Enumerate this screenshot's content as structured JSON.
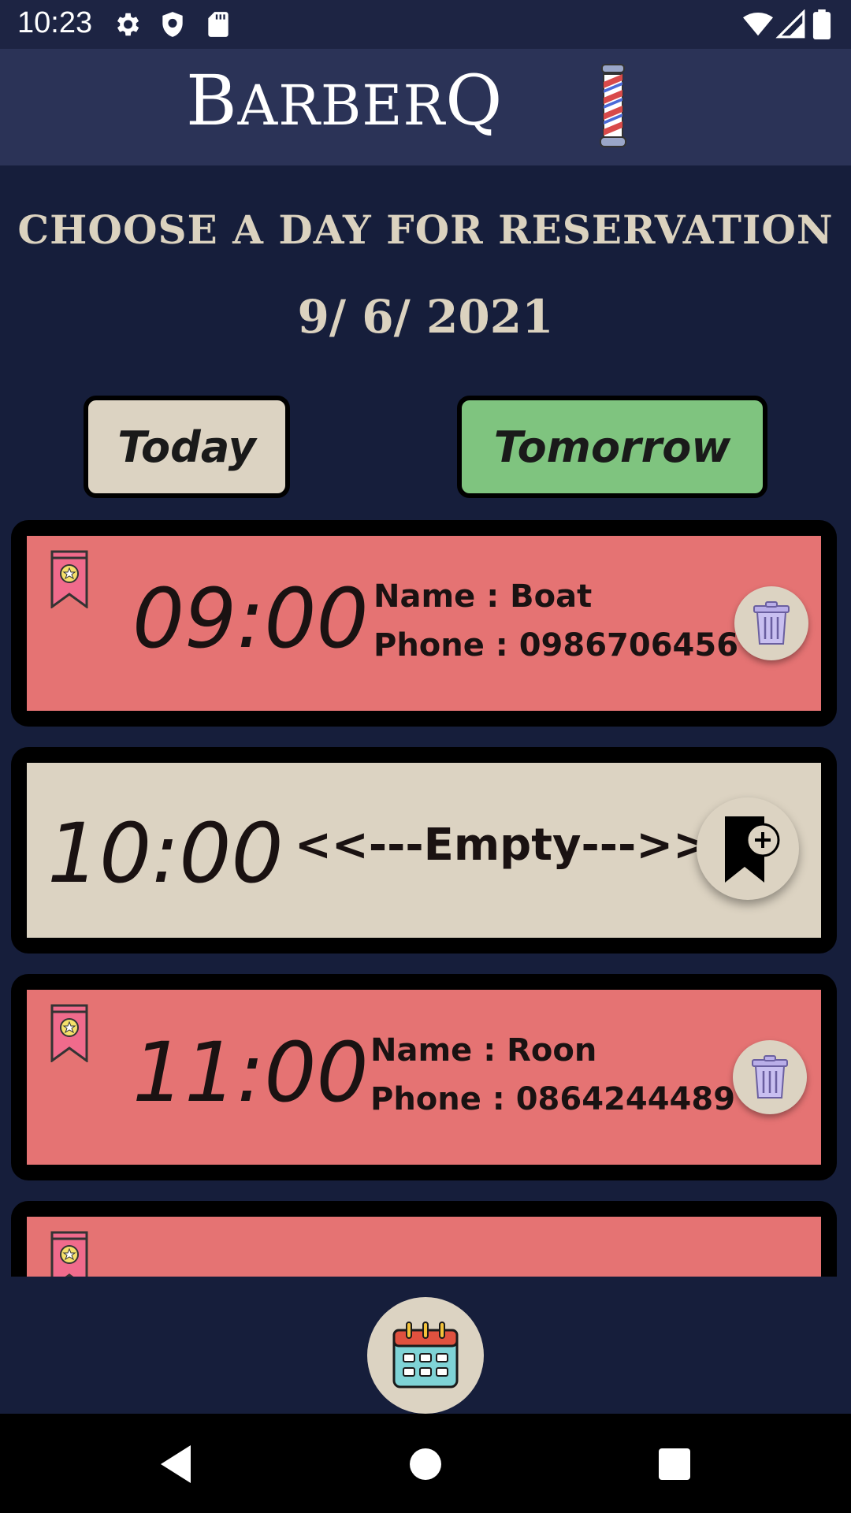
{
  "status_bar": {
    "time": "10:23",
    "icons": [
      "settings-icon",
      "shield-icon",
      "sd-card-icon",
      "wifi-icon",
      "signal-icon",
      "battery-icon"
    ]
  },
  "header": {
    "app_name_first": "B",
    "app_name_rest": "ARBER",
    "app_name_q": "Q",
    "logo_icon": "barber-pole-icon"
  },
  "main": {
    "heading": "CHOOSE A DAY FOR RESERVATION",
    "date": "9/ 6/ 2021",
    "today_label": "Today",
    "tomorrow_label": "Tomorrow"
  },
  "slots": [
    {
      "time": "09:00",
      "status": "booked",
      "name_label": "Name : Boat",
      "phone_label": "Phone : 0986706456"
    },
    {
      "time": "10:00",
      "status": "empty",
      "empty_label": "<<---Empty--->>"
    },
    {
      "time": "11:00",
      "status": "booked",
      "name_label": "Name : Roon",
      "phone_label": "Phone : 0864244489"
    },
    {
      "time": "",
      "status": "booked"
    }
  ],
  "colors": {
    "background": "#161e3b",
    "header": "#2b3357",
    "cream": "#dcd3c2",
    "booked": "#e57373",
    "tomorrow": "#7fc47f"
  },
  "bottom": {
    "calendar_icon": "calendar-icon"
  },
  "nav": {
    "icons": [
      "back-icon",
      "home-icon",
      "recents-icon"
    ]
  }
}
